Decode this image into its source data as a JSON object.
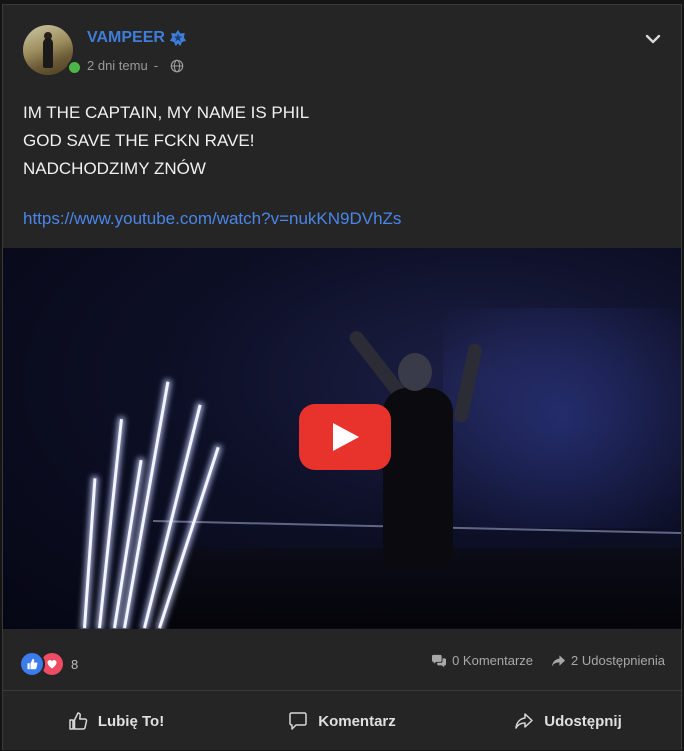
{
  "post": {
    "author": "VAMPEER",
    "time": "2 dni temu",
    "separator": "-",
    "lines": [
      "IM THE CAPTAIN, MY NAME IS PHIL",
      "GOD SAVE THE FCKN RAVE!",
      "NADCHODZIMY ZNÓW"
    ],
    "link": "https://www.youtube.com/watch?v=nukKN9DVhZs"
  },
  "stats": {
    "reaction_count": "8",
    "comments": "0 Komentarze",
    "shares": "2 Udostępnienia"
  },
  "actions": {
    "like": "Lubię To!",
    "comment": "Komentarz",
    "share": "Udostępnij"
  },
  "colors": {
    "author": "#3e7ed8",
    "link": "#4a86e8",
    "play": "#e8332c",
    "online": "#4cb648"
  },
  "icons": [
    "verified-badge-icon",
    "globe-icon",
    "chevron-down-icon",
    "play-icon",
    "like-icon",
    "heart-icon",
    "comments-icon",
    "share-arrow-icon",
    "thumbs-up-icon",
    "comment-bubble-icon"
  ]
}
